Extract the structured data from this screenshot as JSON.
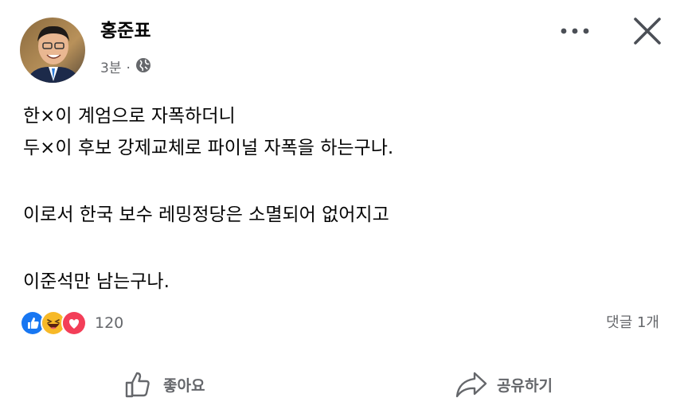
{
  "post": {
    "author": "홍준표",
    "time": "3분",
    "separator": "·",
    "lines": [
      "한×이 계엄으로 자폭하더니",
      "두×이 후보 강제교체로 파이널 자폭을 하는구나.",
      "",
      "이로서 한국 보수 레밍정당은 소멸되어 없어지고",
      "",
      "이준석만 남는구나."
    ]
  },
  "reactions": {
    "types": [
      "like",
      "haha",
      "love"
    ],
    "count": "120"
  },
  "comments": {
    "label": "댓글 1개"
  },
  "actions": {
    "like_label": "좋아요",
    "share_label": "공유하기"
  },
  "icons": {
    "privacy": "globe-icon",
    "more": "more-horizontal-icon",
    "close": "close-icon",
    "like_action": "thumbs-up-outline-icon",
    "share_action": "share-arrow-icon"
  },
  "colors": {
    "like_blue": "#1877f2",
    "love_red": "#f33e58",
    "haha_yellow": "#f7b928",
    "secondary_text": "#65676b"
  }
}
